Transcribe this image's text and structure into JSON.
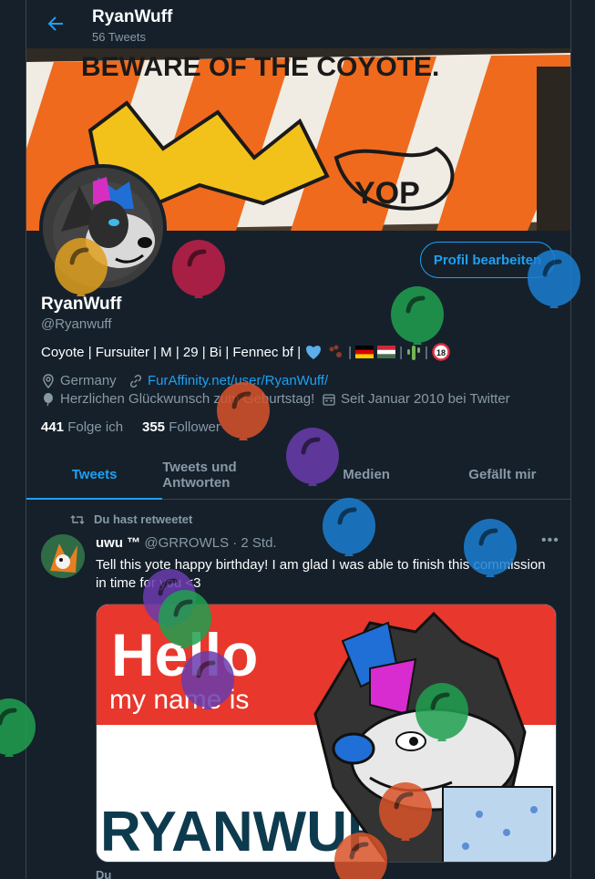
{
  "header": {
    "title": "RyanWuff",
    "tweet_count": "56 Tweets"
  },
  "banner": {
    "graffiti_text": "BEWARE OF THE COYOTE.",
    "graffiti_tag": "YOP"
  },
  "profile": {
    "edit_button": "Profil bearbeiten",
    "name": "RyanWuff",
    "handle": "@Ryanwuff",
    "bio": "Coyote | Fursuiter | M | 29 | Bi | Fennec bf |",
    "bio_emoji": [
      "blue-heart",
      "paw-prints",
      "german-flag",
      "hungarian-flag",
      "cactus",
      "no-one-under-18"
    ],
    "location": "Germany",
    "website": "FurAffinity.net/user/RyanWuff/",
    "birthday": "Herzlichen Glückwunsch zum Geburtstag!",
    "joined": "Seit Januar 2010 bei Twitter",
    "following_count": "441",
    "following_label": "Folge ich",
    "followers_count": "355",
    "followers_label": "Follower"
  },
  "tabs": [
    {
      "label": "Tweets",
      "active": true
    },
    {
      "label": "Tweets und Antworten",
      "active": false
    },
    {
      "label": "Medien",
      "active": false
    },
    {
      "label": "Gefällt mir",
      "active": false
    }
  ],
  "tweet": {
    "retweet_label": "Du hast retweetet",
    "author_name": "uwu ™",
    "author_handle": "@GRROWLS",
    "time": "· 2 Std.",
    "text": "Tell this yote happy birthday! I am glad I was able to finish this commission in time for you <3",
    "image_text_hello": "Hello",
    "image_text_my_name_is": "my name is",
    "image_text_name": "RYANWUFF",
    "next_label": "Du"
  },
  "colors": {
    "background": "#15202b",
    "accent": "#1da1f2",
    "secondary_text": "#8899a6",
    "border": "#38444d"
  },
  "balloon_colors": [
    "#e0a020",
    "#c21f4b",
    "#1c7fd1",
    "#20a050",
    "#d9532a",
    "#6a3cad"
  ]
}
